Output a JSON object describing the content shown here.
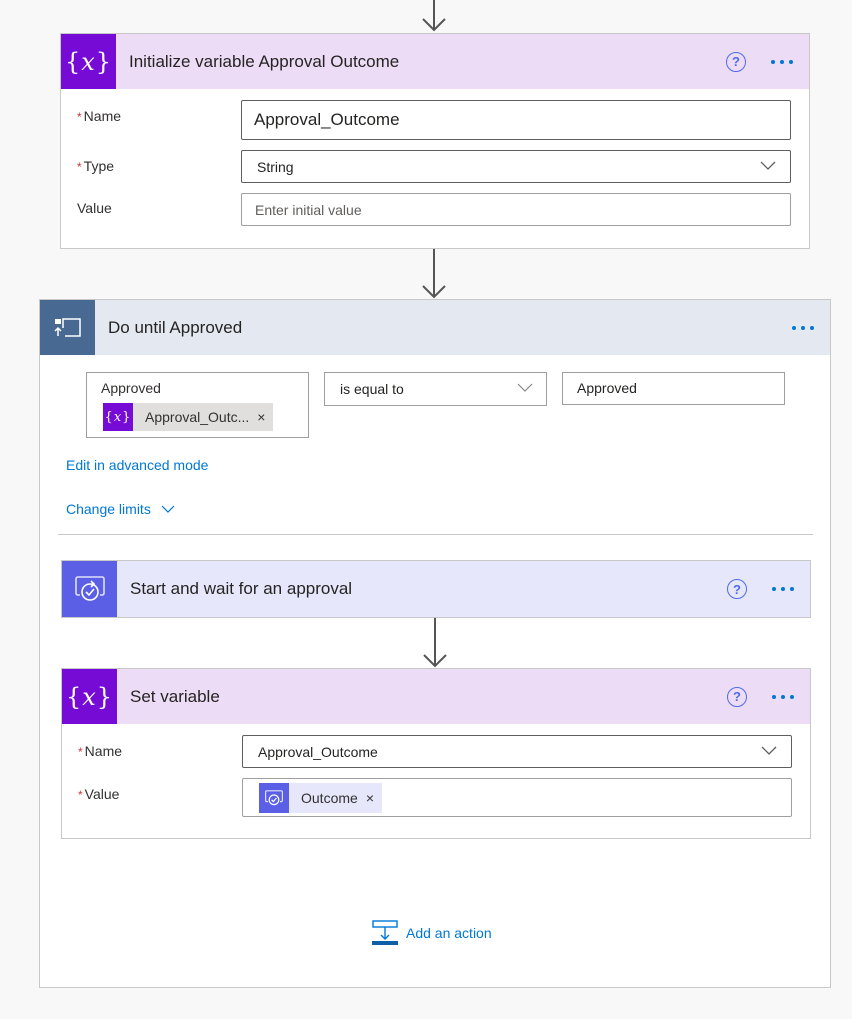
{
  "colors": {
    "variable_brand": "#770bd6",
    "variable_header_bg": "#ecdcf6",
    "loop_brand": "#486991",
    "loop_header_bg": "#e4e8f1",
    "approval_brand": "#5b5fe6",
    "approval_header_bg": "#e6e7fb",
    "link": "#0078d4"
  },
  "init_variable": {
    "title": "Initialize variable Approval Outcome",
    "icon": "variable-icon",
    "help_icon": "question-icon",
    "more_icon": "ellipsis-icon",
    "fields": {
      "name_label": "Name",
      "name_value": "Approval_Outcome",
      "type_label": "Type",
      "type_value": "String",
      "value_label": "Value",
      "value_placeholder": "Enter initial value"
    }
  },
  "do_until": {
    "title": "Do until Approved",
    "icon": "loop-icon",
    "more_icon": "ellipsis-icon",
    "condition": {
      "left_label": "Approved",
      "left_token": "Approval_Outc...",
      "operator": "is equal to",
      "right_value": "Approved"
    },
    "edit_advanced_link": "Edit in advanced mode",
    "change_limits_link": "Change limits"
  },
  "approval_action": {
    "title": "Start and wait for an approval",
    "icon": "approval-icon"
  },
  "set_variable": {
    "title": "Set variable",
    "icon": "variable-icon",
    "fields": {
      "name_label": "Name",
      "name_value": "Approval_Outcome",
      "value_label": "Value",
      "value_token": "Outcome"
    }
  },
  "add_action": {
    "label": "Add an action",
    "icon": "add-action-icon"
  },
  "required_marker": "*",
  "help_glyph": "?",
  "remove_glyph": "×"
}
